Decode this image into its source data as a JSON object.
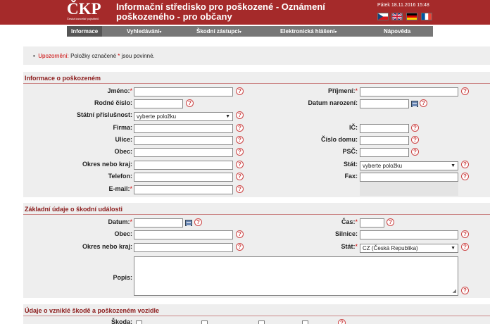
{
  "header": {
    "logo_text": "ČKP",
    "logo_subtext": "Česká kancelář pojistitelů",
    "title_line1": "Informační středisko pro poškozené - Oznámení",
    "title_line2": "poškozeného - pro občany",
    "datetime": "Pátek 18.11.2016 15:48",
    "flags": [
      {
        "name": "czech",
        "colors": [
          "#ffffff",
          "#d7141a",
          "#11457e"
        ]
      },
      {
        "name": "uk",
        "colors": [
          "#012169",
          "#ffffff",
          "#c8102e"
        ]
      },
      {
        "name": "germany",
        "colors": [
          "#000000",
          "#dd0000",
          "#ffce00"
        ]
      },
      {
        "name": "france",
        "colors": [
          "#0055a4",
          "#ffffff",
          "#ef4135"
        ]
      }
    ]
  },
  "nav": {
    "items": [
      {
        "label": "Informace",
        "dropdown": false
      },
      {
        "label": "Vyhledávání",
        "dropdown": true
      },
      {
        "label": "Škodní zástupci",
        "dropdown": true
      },
      {
        "label": "Elektronická hlášení",
        "dropdown": true
      },
      {
        "label": "Nápověda",
        "dropdown": false
      }
    ],
    "arrow": "▾"
  },
  "notice": {
    "bullet": "•",
    "warn": "Upozornění:",
    "text_before": "Položky označené",
    "star": "*",
    "text_after": "jsou povinné."
  },
  "section1": {
    "title": "Informace o poškozeném",
    "jmeno": "Jméno:",
    "prijmeni": "Příjmení:",
    "rodne_cislo": "Rodné číslo:",
    "datum_narozeni": "Datum narození:",
    "statni_prislusnost": "Státní příslušnost:",
    "statni_prislusnost_value": "vyberte položku",
    "firma": "Firma:",
    "ic": "IČ:",
    "ulice": "Ulice:",
    "cislo_domu": "Číslo domu:",
    "obec": "Obec:",
    "psc": "PSČ:",
    "okres": "Okres nebo kraj:",
    "stat": "Stát:",
    "stat_value": "vyberte položku",
    "telefon": "Telefon:",
    "fax": "Fax:",
    "email": "E-mail:"
  },
  "section2": {
    "title": "Základní údaje o škodní události",
    "datum": "Datum:",
    "cas": "Čas:",
    "obec": "Obec:",
    "silnice": "Silnice:",
    "okres": "Okres nebo kraj:",
    "stat": "Stát:",
    "stat_value": "CZ (Česká Republika)",
    "popis": "Popis:"
  },
  "section3": {
    "title": "Údaje o vzniklé škodě a poškozeném vozidle",
    "skoda": "Škoda:"
  },
  "common": {
    "required_mark": "*",
    "help_mark": "?",
    "select_arrow": "▼",
    "resize_mark": "◢"
  }
}
